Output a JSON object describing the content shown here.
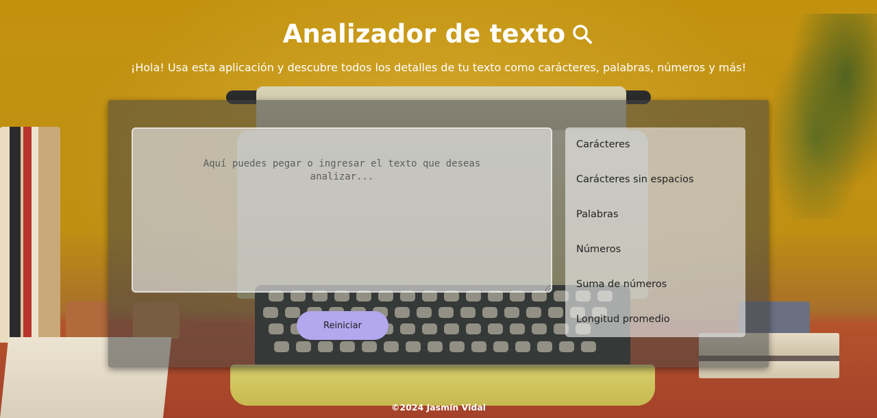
{
  "header": {
    "title": "Analizador de texto",
    "subtitle": "¡Hola! Usa esta aplicación y descubre todos los detalles de tu texto como carácteres, palabras, números y más!",
    "title_icon": "search-icon"
  },
  "editor": {
    "value": "",
    "placeholder": "Aquí puedes pegar o ingresar el texto que deseas analizar...",
    "reset_label": "Reiniciar"
  },
  "stats": {
    "items": [
      {
        "label": "Carácteres"
      },
      {
        "label": "Carácteres sin espacios"
      },
      {
        "label": "Palabras"
      },
      {
        "label": "Números"
      },
      {
        "label": "Suma de números"
      },
      {
        "label": "Longitud promedio"
      }
    ]
  },
  "footer": {
    "text": "©2024 Jasmín Vidal"
  },
  "colors": {
    "accent_button": "#b3a7ee",
    "background_wall": "#c89418",
    "text_light": "#ffffff"
  }
}
